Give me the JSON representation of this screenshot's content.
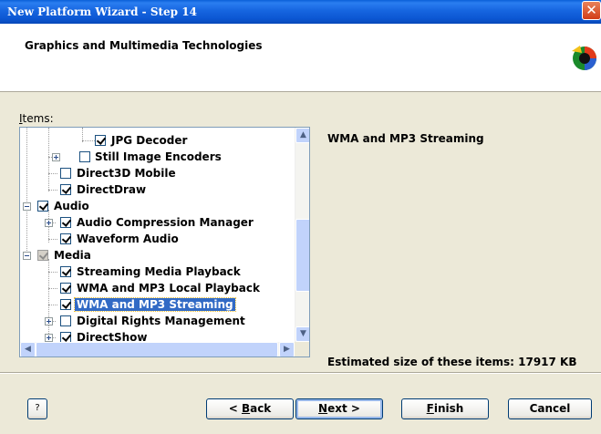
{
  "window": {
    "title": "New Platform Wizard - Step 14",
    "close_glyph": "✕"
  },
  "header": {
    "heading": "Graphics and Multimedia Technologies",
    "logo_icon": "wizard-logo-icon"
  },
  "items": {
    "label_first": "I",
    "label_rest": "tems:",
    "tree": [
      {
        "label": "JPG Decoder",
        "checked": true
      },
      {
        "label": "Still Image Encoders",
        "checked": false
      },
      {
        "label": "Direct3D Mobile",
        "checked": false
      },
      {
        "label": "DirectDraw",
        "checked": true
      },
      {
        "label": "Audio",
        "checked": true
      },
      {
        "label": "Audio Compression Manager",
        "checked": true
      },
      {
        "label": "Waveform Audio",
        "checked": true
      },
      {
        "label": "Media",
        "checked": "partial"
      },
      {
        "label": "Streaming Media Playback",
        "checked": true
      },
      {
        "label": "WMA and MP3 Local Playback",
        "checked": true
      },
      {
        "label": "WMA and MP3 Streaming",
        "checked": true,
        "selected": true
      },
      {
        "label": "Digital Rights Management",
        "checked": false
      },
      {
        "label": "DirectShow",
        "checked": true
      }
    ]
  },
  "description": "WMA and MP3 Streaming",
  "size_text": "Estimated size of these items: 17917 KB",
  "buttons": {
    "help": "?",
    "back_prefix": "< ",
    "back_key": "B",
    "back_rest": "ack",
    "next_key": "N",
    "next_rest": "ext >",
    "finish_key": "F",
    "finish_rest": "inish",
    "cancel": "Cancel"
  },
  "scroll": {
    "up": "▲",
    "down": "▼",
    "left": "◀",
    "right": "▶"
  }
}
